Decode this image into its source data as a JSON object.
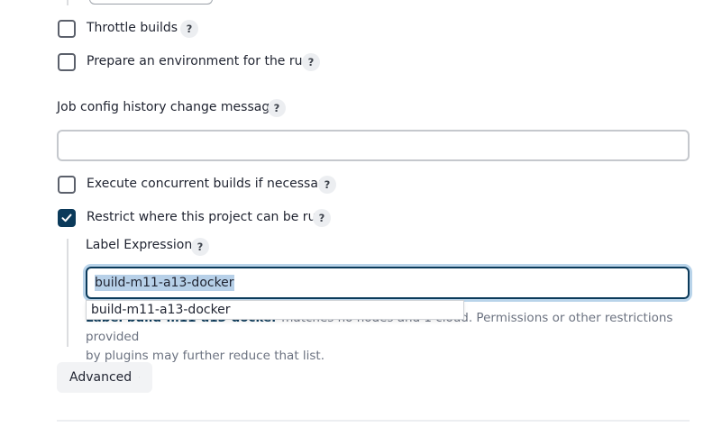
{
  "options": {
    "throttle_builds": {
      "label": "Throttle builds",
      "checked": false,
      "help": "?"
    },
    "prepare_environment": {
      "label": "Prepare an environment for the run",
      "checked": false,
      "help": "?"
    },
    "execute_concurrent": {
      "label": "Execute concurrent builds if necessary",
      "checked": false,
      "help": "?"
    },
    "restrict_where": {
      "label": "Restrict where this project can be run",
      "checked": true,
      "help": "?"
    }
  },
  "job_config_history": {
    "label": "Job config history change message",
    "help": "?",
    "value": ""
  },
  "label_expression": {
    "label": "Label Expression",
    "help": "?",
    "value": "build-m11-a13-docker",
    "autocomplete": [
      "build-m11-a13-docker"
    ],
    "validation": {
      "strong": "Label build-m11-a13-docker",
      "line1_rest": " matches no nodes and 1 cloud. Permissions or other restrictions provided",
      "line2": "by plugins may further reduce that list."
    }
  },
  "advanced": {
    "label": "Advanced",
    "icon": "chevron-down-icon"
  },
  "colors": {
    "accent": "#0b3a5a",
    "selection": "#b7d0e8",
    "focus_ring": "#b9d4ea"
  }
}
